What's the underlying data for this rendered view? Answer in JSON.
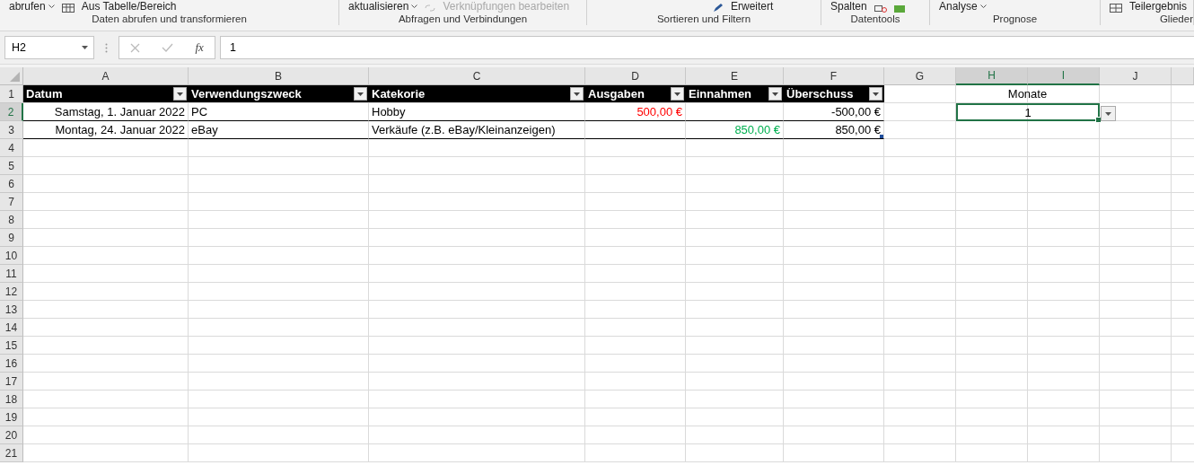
{
  "ribbon": {
    "groups": [
      {
        "label": "Daten abrufen und transformieren",
        "items": [
          {
            "text": "abrufen",
            "caret": true,
            "disabled": false
          },
          {
            "text": "Aus Tabelle/Bereich",
            "caret": false,
            "disabled": false
          }
        ]
      },
      {
        "label": "Abfragen und Verbindungen",
        "items": [
          {
            "text": "aktualisieren",
            "caret": true,
            "disabled": false
          },
          {
            "text": "Verknüpfungen bearbeiten",
            "caret": false,
            "disabled": true
          }
        ]
      },
      {
        "label": "Sortieren und Filtern",
        "items": [
          {
            "text": "Erweitert",
            "caret": false,
            "disabled": false
          }
        ]
      },
      {
        "label": "Datentools",
        "items": [
          {
            "text": "Spalten",
            "caret": false,
            "disabled": false
          }
        ]
      },
      {
        "label": "Prognose",
        "items": [
          {
            "text": "Analyse",
            "caret": true,
            "disabled": false
          }
        ]
      },
      {
        "label": "Glieder",
        "items": [
          {
            "text": "Teilergebnis",
            "caret": false,
            "disabled": false
          }
        ]
      }
    ]
  },
  "formula_bar": {
    "name_box": "H2",
    "function_symbol": "fx",
    "value": "1"
  },
  "sheet": {
    "columns": [
      {
        "label": "A",
        "selected": false
      },
      {
        "label": "B",
        "selected": false
      },
      {
        "label": "C",
        "selected": false
      },
      {
        "label": "D",
        "selected": false
      },
      {
        "label": "E",
        "selected": false
      },
      {
        "label": "F",
        "selected": false
      },
      {
        "label": "G",
        "selected": false
      },
      {
        "label": "H",
        "selected": true
      },
      {
        "label": "I",
        "selected": true
      },
      {
        "label": "J",
        "selected": false
      }
    ],
    "rows": [
      {
        "label": "1",
        "selected": false
      },
      {
        "label": "2",
        "selected": true
      },
      {
        "label": "3",
        "selected": false
      },
      {
        "label": "4",
        "selected": false
      },
      {
        "label": "5",
        "selected": false
      },
      {
        "label": "6",
        "selected": false
      },
      {
        "label": "7",
        "selected": false
      },
      {
        "label": "8",
        "selected": false
      },
      {
        "label": "9",
        "selected": false
      },
      {
        "label": "10",
        "selected": false
      },
      {
        "label": "11",
        "selected": false
      },
      {
        "label": "12",
        "selected": false
      },
      {
        "label": "13",
        "selected": false
      },
      {
        "label": "14",
        "selected": false
      },
      {
        "label": "15",
        "selected": false
      },
      {
        "label": "16",
        "selected": false
      },
      {
        "label": "17",
        "selected": false
      },
      {
        "label": "18",
        "selected": false
      },
      {
        "label": "19",
        "selected": false
      },
      {
        "label": "20",
        "selected": false
      },
      {
        "label": "21",
        "selected": false
      }
    ],
    "table": {
      "headers": [
        "Datum",
        "Verwendungszweck",
        "Katekorie",
        "Ausgaben",
        "Einnahmen",
        "Überschuss"
      ],
      "rows": [
        [
          {
            "text": "Samstag, 1. Januar 2022",
            "kind": "number",
            "color": "#000000"
          },
          {
            "text": "PC",
            "kind": "text",
            "color": "#000000"
          },
          {
            "text": "Hobby",
            "kind": "text",
            "color": "#000000"
          },
          {
            "text": "500,00 €",
            "kind": "number",
            "color": "#ff0000"
          },
          {
            "text": "",
            "kind": "number",
            "color": "#000000"
          },
          {
            "text": "-500,00 €",
            "kind": "number",
            "color": "#000000"
          }
        ],
        [
          {
            "text": "Montag, 24. Januar 2022",
            "kind": "number",
            "color": "#000000"
          },
          {
            "text": "eBay",
            "kind": "text",
            "color": "#000000"
          },
          {
            "text": "Verkäufe (z.B. eBay/Kleinanzeigen)",
            "kind": "text",
            "color": "#000000"
          },
          {
            "text": "",
            "kind": "number",
            "color": "#000000"
          },
          {
            "text": "850,00 €",
            "kind": "number",
            "color": "#00b050"
          },
          {
            "text": "850,00 €",
            "kind": "number",
            "color": "#000000"
          }
        ]
      ]
    },
    "side": {
      "label": "Monate",
      "value": "1",
      "selected": true
    }
  }
}
